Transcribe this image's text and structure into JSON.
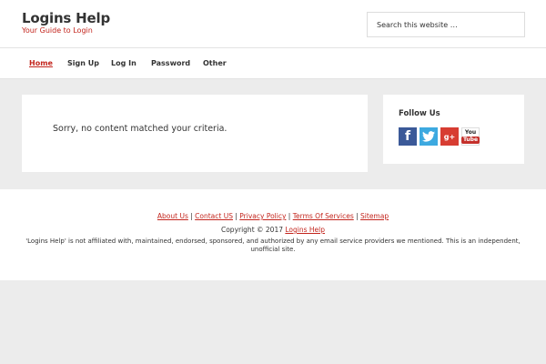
{
  "header": {
    "site_title": "Logins Help",
    "site_description": "Your Guide to Login",
    "search_placeholder": "Search this website …"
  },
  "nav": {
    "items": [
      {
        "label": "Home",
        "active": true
      },
      {
        "label": "Sign Up",
        "active": false
      },
      {
        "label": "Log In",
        "active": false
      },
      {
        "label": "Password",
        "active": false
      },
      {
        "label": "Other",
        "active": false
      }
    ]
  },
  "main": {
    "message": "Sorry, no content matched your criteria."
  },
  "sidebar": {
    "title": "Follow Us",
    "social": [
      {
        "name": "facebook-icon",
        "glyph": "f"
      },
      {
        "name": "twitter-icon",
        "glyph": "t"
      },
      {
        "name": "google-plus-icon",
        "glyph": "g+"
      },
      {
        "name": "youtube-icon",
        "glyph_top": "You",
        "glyph_bottom": "Tube"
      }
    ]
  },
  "footer": {
    "links": [
      "About Us",
      "Contact US",
      "Privacy Policy",
      "Terms Of Services",
      "Sitemap"
    ],
    "separator": " | ",
    "copyright_prefix": "Copyright © 2017 ",
    "copyright_link": "Logins Help",
    "disclaimer": "'Logins Help' is not affiliated with, maintained, endorsed, sponsored, and authorized by any email service providers we mentioned. This is an independent, unofficial site."
  },
  "colors": {
    "accent": "#c3251d",
    "page_background": "#ececec",
    "facebook": "#3b5998",
    "twitter": "#3da9e0",
    "google_plus": "#d73d32",
    "youtube": "#c4302b"
  }
}
